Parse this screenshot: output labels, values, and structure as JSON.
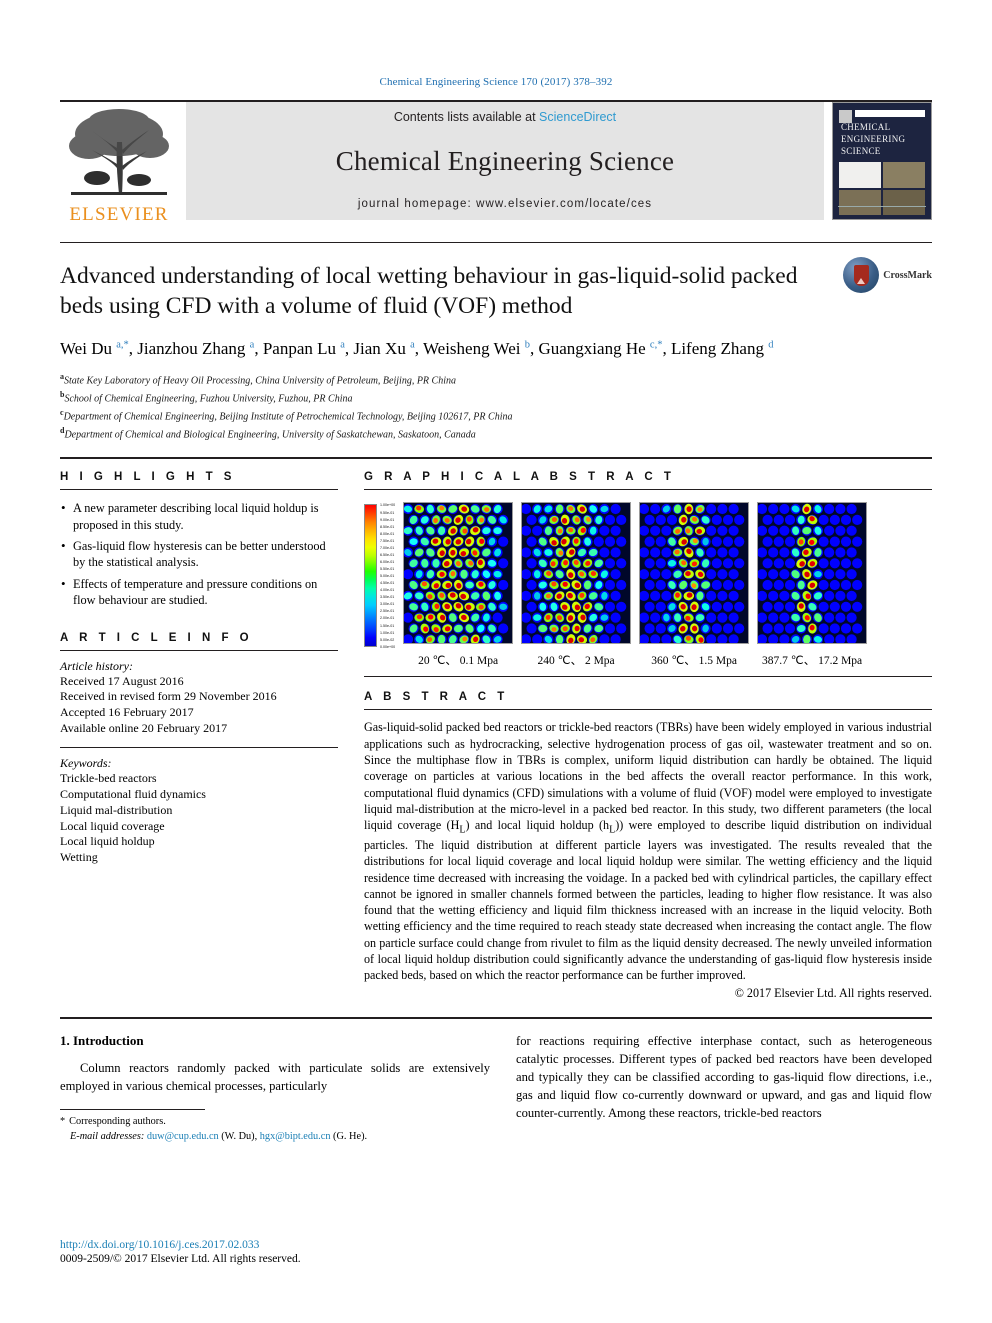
{
  "running_head": "Chemical Engineering Science 170 (2017) 378–392",
  "masthead": {
    "publisher": "ELSEVIER",
    "contents_prefix": "Contents lists available at",
    "contents_link": "ScienceDirect",
    "journal_title": "Chemical Engineering Science",
    "homepage": "journal homepage: www.elsevier.com/locate/ces",
    "cover_title": "CHEMICAL ENGINEERING SCIENCE"
  },
  "article": {
    "title": "Advanced understanding of local wetting behaviour in gas-liquid-solid packed beds using CFD with a volume of fluid (VOF) method",
    "crossmark_label": "CrossMark",
    "authors": [
      {
        "name": "Wei Du",
        "marks": "a,*"
      },
      {
        "name": "Jianzhou Zhang",
        "marks": "a"
      },
      {
        "name": "Panpan Lu",
        "marks": "a"
      },
      {
        "name": "Jian Xu",
        "marks": "a"
      },
      {
        "name": "Weisheng Wei",
        "marks": "b"
      },
      {
        "name": "Guangxiang He",
        "marks": "c,*"
      },
      {
        "name": "Lifeng Zhang",
        "marks": "d"
      }
    ],
    "affiliations": [
      {
        "mark": "a",
        "text": "State Key Laboratory of Heavy Oil Processing, China University of Petroleum, Beijing, PR China"
      },
      {
        "mark": "b",
        "text": "School of Chemical Engineering, Fuzhou University, Fuzhou, PR China"
      },
      {
        "mark": "c",
        "text": "Department of Chemical Engineering, Beijing Institute of Petrochemical Technology, Beijing 102617, PR China"
      },
      {
        "mark": "d",
        "text": "Department of Chemical and Biological Engineering, University of Saskatchewan, Saskatoon, Canada"
      }
    ]
  },
  "highlights": {
    "heading": "H I G H L I G H T S",
    "items": [
      "A new parameter describing local liquid holdup is proposed in this study.",
      "Gas-liquid flow hysteresis can be better understood by the statistical analysis.",
      "Effects of temperature and pressure conditions on flow behaviour are studied."
    ]
  },
  "article_info": {
    "heading": "A R T I C L E   I N F O",
    "history_title": "Article history:",
    "history": [
      "Received 17 August 2016",
      "Received in revised form 29 November 2016",
      "Accepted 16 February 2017",
      "Available online 20 February 2017"
    ],
    "keywords_title": "Keywords:",
    "keywords": [
      "Trickle-bed reactors",
      "Computational fluid dynamics",
      "Liquid mal-distribution",
      "Local liquid coverage",
      "Local liquid holdup",
      "Wetting"
    ]
  },
  "graphical_abstract": {
    "heading": "G R A P H I C A L   A B S T R A C T",
    "colorbar_labels": [
      "1.00e+00",
      "9.50e-01",
      "9.00e-01",
      "8.50e-01",
      "8.00e-01",
      "7.50e-01",
      "7.00e-01",
      "6.50e-01",
      "6.00e-01",
      "5.50e-01",
      "5.00e-01",
      "4.50e-01",
      "4.00e-01",
      "3.50e-01",
      "3.00e-01",
      "2.50e-01",
      "2.00e-01",
      "1.50e-01",
      "1.00e-01",
      "5.00e-02",
      "0.00e+00"
    ],
    "panels": [
      {
        "caption": "20 ℃、 0.1 Mpa",
        "seed": 7
      },
      {
        "caption": "240 ℃、 2 Mpa",
        "seed": 19
      },
      {
        "caption": "360 ℃、 1.5 Mpa",
        "seed": 33
      },
      {
        "caption": "387.7 ℃、 17.2 Mpa",
        "seed": 51
      }
    ]
  },
  "abstract": {
    "heading": "A B S T R A C T",
    "text": "Gas-liquid-solid packed bed reactors or trickle-bed reactors (TBRs) have been widely employed in various industrial applications such as hydrocracking, selective hydrogenation process of gas oil, wastewater treatment and so on. Since the multiphase flow in TBRs is complex, uniform liquid distribution can hardly be obtained. The liquid coverage on particles at various locations in the bed affects the overall reactor performance. In this work, computational fluid dynamics (CFD) simulations with a volume of fluid (VOF) model were employed to investigate liquid mal-distribution at the micro-level in a packed bed reactor. In this study, two different parameters (the local liquid coverage (HL) and local liquid holdup (hL)) were employed to describe liquid distribution on individual particles. The liquid distribution at different particle layers was investigated. The results revealed that the distributions for local liquid coverage and local liquid holdup were similar. The wetting efficiency and the liquid residence time decreased with increasing the voidage. In a packed bed with cylindrical particles, the capillary effect cannot be ignored in smaller channels formed between the particles, leading to higher flow resistance. It was also found that the wetting efficiency and liquid film thickness increased with an increase in the liquid velocity. Both wetting efficiency and the time required to reach steady state decreased when increasing the contact angle. The flow on particle surface could change from rivulet to film as the liquid density decreased. The newly unveiled information of local liquid holdup distribution could significantly advance the understanding of gas-liquid flow hysteresis inside packed beds, based on which the reactor performance can be further improved.",
    "copyright": "© 2017 Elsevier Ltd. All rights reserved."
  },
  "introduction": {
    "heading": "1. Introduction",
    "left_text": "Column reactors randomly packed with particulate solids are extensively employed in various chemical processes, particularly",
    "right_text": "for reactions requiring effective interphase contact, such as heterogeneous catalytic processes. Different types of packed bed reactors have been developed and typically they can be classified according to gas-liquid flow directions, i.e., gas and liquid flow co-currently downward or upward, and gas and liquid flow counter-currently. Among these reactors, trickle-bed reactors"
  },
  "footnote": {
    "corresponding": "Corresponding authors.",
    "email_label": "E-mail addresses:",
    "email1": "duw@cup.edu.cn",
    "email1_who": "(W. Du),",
    "email2": "hgx@bipt.edu.cn",
    "email2_who": "(G. He)."
  },
  "page_footer": {
    "doi": "http://dx.doi.org/10.1016/j.ces.2017.02.033",
    "issn": "0009-2509/© 2017 Elsevier Ltd. All rights reserved."
  },
  "colors": {
    "link_blue": "#1b7fb5",
    "sciencedirect_blue": "#2f9ad0",
    "elsevier_orange": "#ea8f1e",
    "rule_black": "#231f20"
  }
}
